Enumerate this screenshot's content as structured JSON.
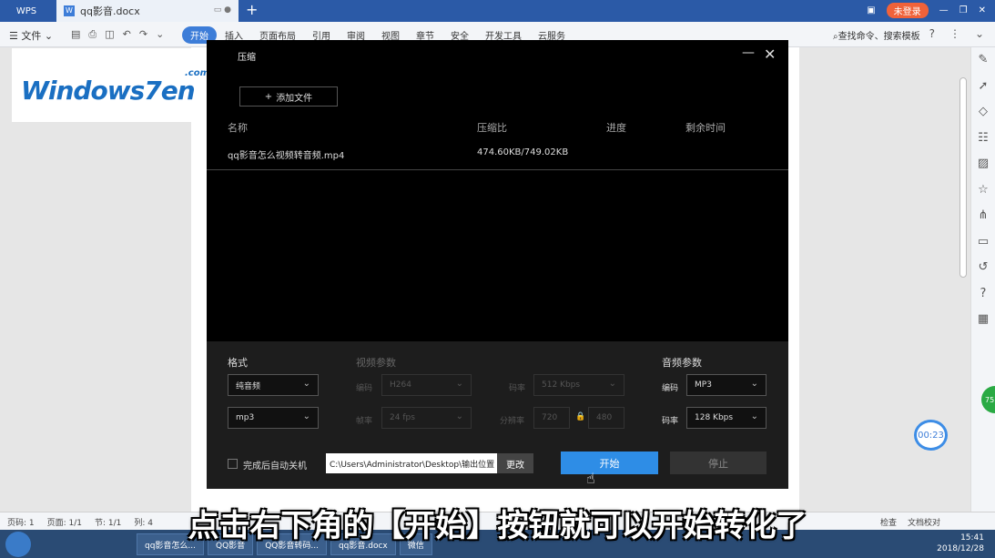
{
  "tabs": {
    "app": "WPS",
    "doc": "qq影音.docx",
    "login": "未登录"
  },
  "menu": {
    "file": "文件",
    "items": [
      "开始",
      "插入",
      "页面布局",
      "引用",
      "审阅",
      "视图",
      "章节",
      "安全",
      "开发工具",
      "云服务"
    ],
    "search": "查找命令、搜索模板"
  },
  "logo": {
    "text": "Windows7en",
    "com": ".com"
  },
  "dialog": {
    "title": "压缩",
    "add_file": "添加文件",
    "columns": [
      "名称",
      "压缩比",
      "进度",
      "剩余时间"
    ],
    "file": {
      "name": "qq影音怎么视频转音频.mp4",
      "ratio": "474.60KB/749.02KB"
    },
    "format": {
      "label": "格式",
      "type": "纯音频",
      "container": "mp3"
    },
    "video": {
      "label": "视频参数",
      "codec_label": "编码",
      "codec": "H264",
      "fps_label": "帧率",
      "fps": "24 fps",
      "bitrate_label": "码率",
      "bitrate": "512 Kbps",
      "resolution_label": "分辨率",
      "width": "720",
      "height": "480"
    },
    "audio": {
      "label": "音频参数",
      "codec_label": "编码",
      "codec": "MP3",
      "bitrate_label": "码率",
      "bitrate": "128 Kbps"
    },
    "shutdown": "完成后自动关机",
    "output_path": "C:\\Users\\Administrator\\Desktop\\输出位置",
    "change": "更改",
    "start": "开始",
    "stop": "停止"
  },
  "timer": "00:23",
  "badge": "75",
  "status": {
    "page": "页码: 1",
    "pages": "页面: 1/1",
    "section": "节: 1/1",
    "col": "列: 4",
    "check": "检查",
    "extra": "文档校对"
  },
  "taskbar": {
    "items": [
      "qq影音怎么...",
      "QQ影音",
      "QQ影音转码...",
      "qq影音.docx",
      "微信"
    ],
    "time": "15:41",
    "date": "2018/12/28"
  },
  "caption": "点击右下角的【开始】按钮就可以开始转化了"
}
